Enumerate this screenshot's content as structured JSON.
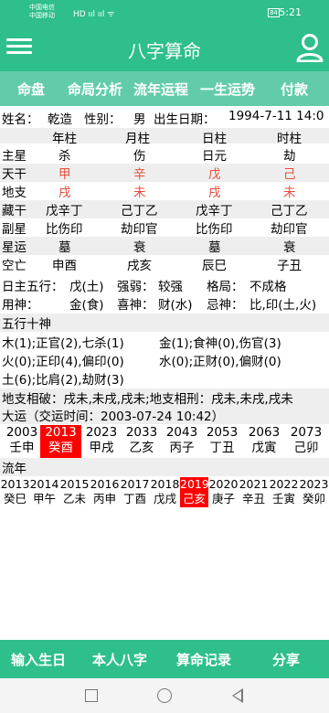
{
  "statusbar": {
    "carrier1": "中国电信",
    "carrier2": "中国移动",
    "signal": "HD ııl ııl ᯤ",
    "battery": "84",
    "time": "5:21"
  },
  "appbar": {
    "title": "八字算命"
  },
  "tabs": [
    "命盘",
    "命局分析",
    "流年运程",
    "一生运势",
    "付款"
  ],
  "info": {
    "name_label": "姓名：",
    "name": "乾造",
    "gender_label": "性别：",
    "gender": "男",
    "birth_label": "出生日期：",
    "birth": "1994-7-11 14:0"
  },
  "pillars": {
    "headers": [
      "年柱",
      "月柱",
      "日柱",
      "时柱"
    ],
    "rows": [
      {
        "label": "主星",
        "cells": [
          "杀",
          "伤",
          "日元",
          "劫"
        ]
      },
      {
        "label": "天干",
        "cells": [
          "甲",
          "辛",
          "戊",
          "己"
        ]
      },
      {
        "label": "地支",
        "cells": [
          "戌",
          "未",
          "戌",
          "未"
        ]
      },
      {
        "label": "藏干",
        "cells": [
          "戊辛丁",
          "己丁乙",
          "戊辛丁",
          "己丁乙"
        ]
      },
      {
        "label": "副星",
        "cells": [
          "比伤印",
          "劫印官",
          "比伤印",
          "劫印官"
        ]
      },
      {
        "label": "星运",
        "cells": [
          "墓",
          "衰",
          "墓",
          "衰"
        ]
      },
      {
        "label": "空亡",
        "cells": [
          "申酉",
          "戌亥",
          "辰巳",
          "子丑"
        ]
      }
    ]
  },
  "wuxing": {
    "label": "日主五行：",
    "value": "戊(土)",
    "strength_label": "强弱：",
    "strength": "较强",
    "pattern_label": "格局：",
    "pattern": "不成格"
  },
  "shen": {
    "use_label": "用神：",
    "use": "金(食)",
    "like_label": "喜神：",
    "like": "财(水)",
    "avoid_label": "忌神：",
    "avoid": "比,印(土,火)"
  },
  "wuxing_shishen": {
    "title": "五行十神",
    "rows": [
      [
        "木(1);正官(2),七杀(1)",
        "金(1);食神(0),伤官(3)"
      ],
      [
        "火(0);正印(4),偏印(0)",
        "水(0);正财(0),偏财(0)"
      ],
      [
        "土(6);比肩(2),劫财(3)",
        ""
      ]
    ]
  },
  "dizhi": "地支相破：戌未,未戌,戌未;地支相刑：戌未,未戌,戌未",
  "dayun": {
    "title": "大运（交运时间：2003-07-24 10:42）",
    "years": [
      "2003",
      "2013",
      "2023",
      "2033",
      "2043",
      "2053",
      "2063",
      "2073"
    ],
    "ganzhi": [
      "壬申",
      "癸酉",
      "甲戌",
      "乙亥",
      "丙子",
      "丁丑",
      "戊寅",
      "己卯"
    ]
  },
  "liunian": {
    "title": "流年",
    "years": [
      "2013",
      "2014",
      "2015",
      "2016",
      "2017",
      "2018",
      "2019",
      "2020",
      "2021",
      "2022",
      "2023"
    ],
    "ganzhi": [
      "癸巳",
      "甲午",
      "乙未",
      "丙申",
      "丁酉",
      "戊戌",
      "己亥",
      "庚子",
      "辛丑",
      "壬寅",
      "癸卯"
    ]
  },
  "bottombar": [
    "输入生日",
    "本人八字",
    "算命记录",
    "分享"
  ],
  "colors": {
    "primary": "#2ebf8b",
    "tabbar": "#62ccaa",
    "highlight": "#ff0000",
    "ganzhi_red": "#e84b3a"
  }
}
